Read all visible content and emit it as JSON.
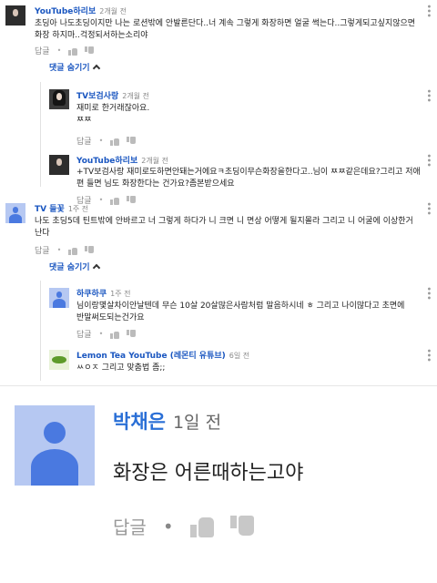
{
  "comments": [
    {
      "author": "YouTube하리보",
      "time": "2개월 전",
      "text": "초딩아 나도초딩이지만 나는 로션밖에 안발른단다..너 계속 그렇게 화장하면 얼굴 썩는다..그렇게되고싶지않으면 화장 하지마..걱정되서하는소리야",
      "reply_label": "답글",
      "toggle_label": "댓글 숨기기",
      "avatar": "dark-hair-avatar"
    },
    {
      "author": "TV보검사랑",
      "time": "2개월 전",
      "text": "재미로 한거래잖아요.\nㅉㅉ",
      "reply_label": "답글",
      "avatar": "dark-hair-avatar"
    },
    {
      "author": "YouTube하리보",
      "time": "2개월 전",
      "text": "+TV보검사랑 재미로도하면안돼는거에요ㅋ초딩이무슨화장을한다고..님이 ㅉㅉ같은데요?그리고 저애 편 들면 님도 화장한다는 건가요?좀본받으세요",
      "reply_label": "답글",
      "avatar": "dark-hair-avatar"
    },
    {
      "author": "TV 들꽃",
      "time": "1주 전",
      "text": "나도 초딩5데 틴트밖에 안바르고 너 그렇게 하다가 니 크면 니 면상 어떻게 될지몰라 그리고 니 어굴에 이상한거 난다",
      "reply_label": "답글",
      "toggle_label": "댓글 숨기기",
      "avatar": "default-user-avatar"
    },
    {
      "author": "하쿠하쿠",
      "time": "1주 전",
      "text": "님이랑몇살차이안날텐데 무슨 10살 20살많은사람처럼 말음하시네 ㅎ 그리고 나이많다고 초면에 반말써도되는건가요",
      "reply_label": "답글",
      "avatar": "default-user-avatar"
    },
    {
      "author": "Lemon Tea YouTube (레몬티 유튜브)",
      "time": "6일 전",
      "text": "ㅆㅇㅈ 그리고 맞춤법 좀;;",
      "avatar": "lemon-tea-avatar"
    }
  ],
  "zoomed": {
    "author": "박채은",
    "time": "1일 전",
    "text": "화장은 어른때하는고야",
    "reply_label": "답글"
  }
}
